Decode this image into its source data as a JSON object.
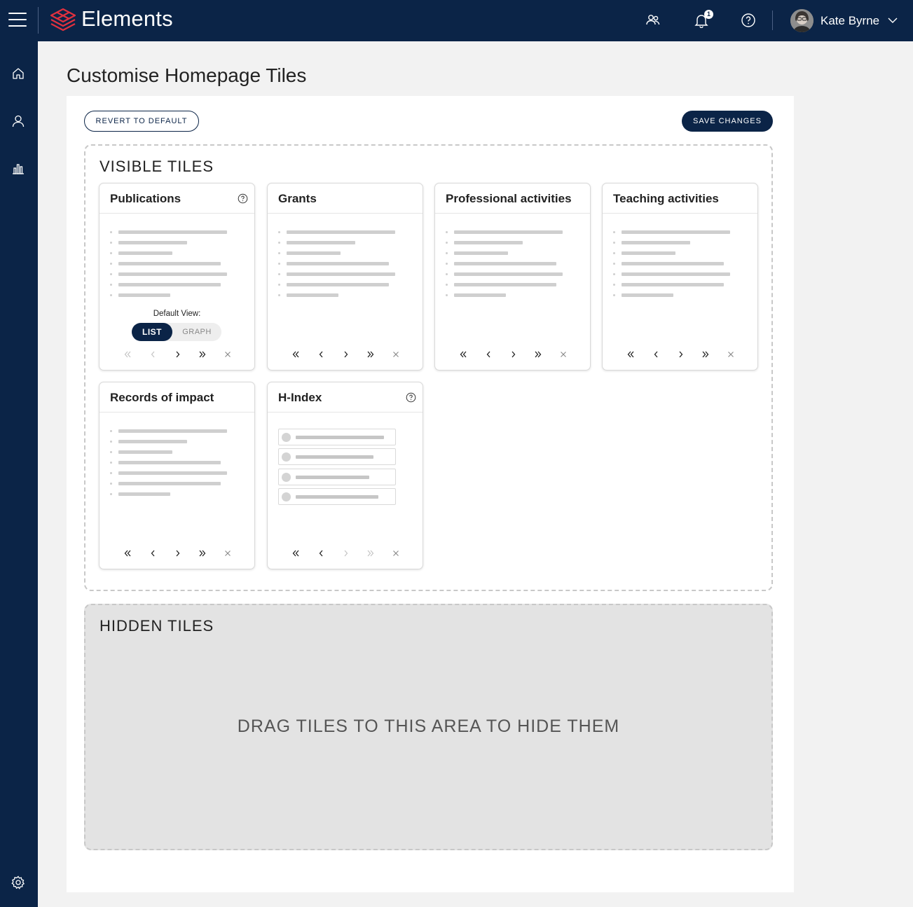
{
  "app": {
    "brand": "Elements",
    "notifications_count": "1",
    "user_name": "Kate Byrne"
  },
  "icons": {
    "menu": "hamburger-icon",
    "logo": "layers-logo-icon",
    "people": "people-icon",
    "bell": "bell-icon",
    "help": "question-circle-icon",
    "home": "home-icon",
    "profile": "person-icon",
    "reports": "bar-chart-icon",
    "settings": "gear-icon"
  },
  "colors": {
    "navy": "#0b2447",
    "logo_red": "#e0313f"
  },
  "page": {
    "title": "Customise Homepage Tiles",
    "revert_label": "REVERT TO DEFAULT",
    "save_label": "SAVE CHANGES"
  },
  "visible": {
    "title": "VISIBLE TILES",
    "tiles": [
      {
        "title": "Publications"
      },
      {
        "title": "Grants"
      },
      {
        "title": "Professional activities"
      },
      {
        "title": "Teaching activities"
      },
      {
        "title": "Records of impact"
      },
      {
        "title": "H-Index"
      }
    ],
    "default_view_label": "Default View:",
    "toggle_list": "LIST",
    "toggle_graph": "GRAPH"
  },
  "hidden": {
    "title": "HIDDEN TILES",
    "message": "DRAG TILES TO THIS AREA TO HIDE THEM"
  }
}
